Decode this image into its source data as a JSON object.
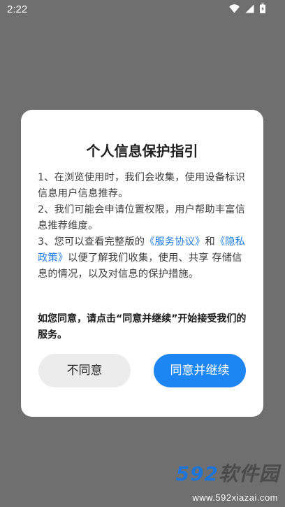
{
  "status_bar": {
    "time": "2:22",
    "icons": [
      "wifi-icon",
      "signal-icon",
      "battery-icon"
    ]
  },
  "dialog": {
    "title": "个人信息保护指引",
    "item1": "1、在浏览使用时，我们会收集，使用设备标识信息用户信息推荐。",
    "item2": "2、我们可能会申请位置权限，用户帮助丰富信息推荐维度。",
    "item3_prefix": "3、您可以查看完整版的",
    "service_agreement_link": "《服务协议》",
    "item3_and": "和",
    "privacy_policy_link": "《隐私政策》",
    "item3_suffix": "以便了解我们收集，使用、共享 存储信息的情况，以及对信息的保护措施。",
    "notice": "如您同意，请点击“同意并继续”开始接受我们的服务。",
    "disagree_button": "不同意",
    "agree_button": "同意并继续"
  },
  "watermark": {
    "brand_number": "592",
    "brand_text": "软件园",
    "url": "www.592xiazai.com"
  },
  "colors": {
    "overlay_background": "#6f6f6f",
    "link": "#1f7ee8",
    "primary_button": "#1e86f2",
    "secondary_button": "#ececec"
  }
}
